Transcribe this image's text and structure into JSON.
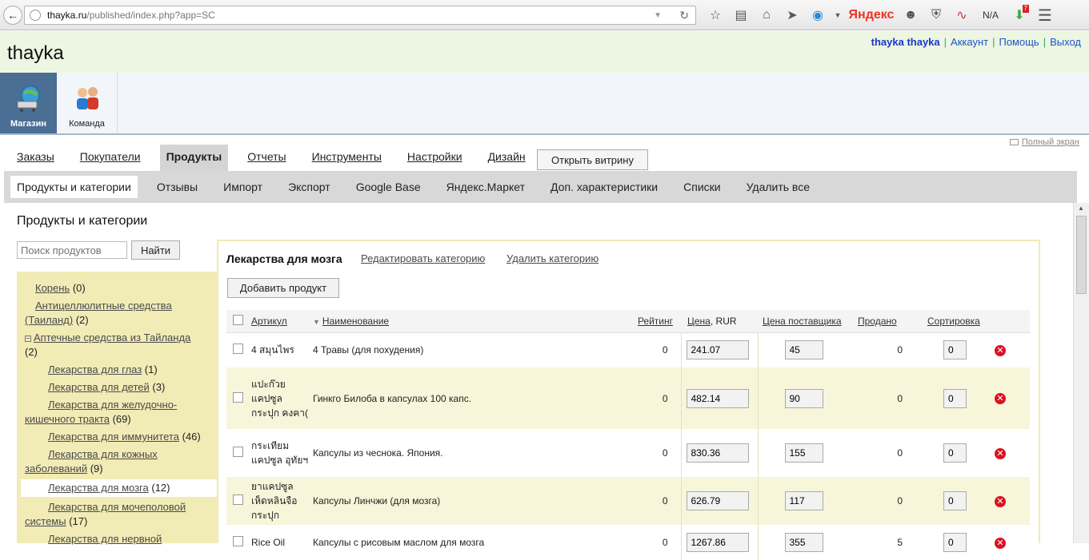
{
  "browser": {
    "url_host": "thayka.ru",
    "url_path": "/published/index.php?app=SC",
    "yandex_label": "Яндекс",
    "weather_label": "N/A",
    "notification_count": "7"
  },
  "header": {
    "brand": "thayka",
    "username": "thayka thayka",
    "account_link": "Аккаунт",
    "help_link": "Помощь",
    "logout_link": "Выход"
  },
  "apps": {
    "shop_label": "Магазин",
    "team_label": "Команда"
  },
  "fullscreen_label": "Полный экран",
  "main_nav": {
    "orders": "Заказы",
    "customers": "Покупатели",
    "products": "Продукты",
    "reports": "Отчеты",
    "tools": "Инструменты",
    "settings": "Настройки",
    "design": "Дизайн",
    "storefront_button": "Открыть витрину"
  },
  "sub_nav": {
    "products_categories": "Продукты и категории",
    "reviews": "Отзывы",
    "import": "Импорт",
    "export": "Экспорт",
    "google_base": "Google Base",
    "yandex_market": "Яндекс.Маркет",
    "extra_features": "Доп. характеристики",
    "lists": "Списки",
    "delete_all": "Удалить все"
  },
  "page": {
    "title": "Продукты и категории",
    "search_placeholder": "Поиск продуктов",
    "search_button": "Найти"
  },
  "tree": {
    "root": "Корень",
    "root_count": "(0)",
    "cellulite": "Антицеллюлитные средства (Таиланд)",
    "cellulite_count": "(2)",
    "pharmacy": "Аптечные средства из Тайланда",
    "pharmacy_count": "(2)",
    "eyes": "Лекарства для глаз",
    "eyes_count": "(1)",
    "kids": "Лекарства для детей",
    "kids_count": "(3)",
    "gi": "Лекарства для желудочно-кишечного тракта",
    "gi_count": "(69)",
    "immunity": "Лекарства для иммунитета",
    "immunity_count": "(46)",
    "skin": "Лекарства для кожных заболеваний",
    "skin_count": "(9)",
    "brain": "Лекарства для мозга",
    "brain_count": "(12)",
    "urogenital": "Лекарства для мочеполовой системы",
    "urogenital_count": "(17)",
    "nervous": "Лекарства для нервной"
  },
  "category": {
    "name": "Лекарства для мозга",
    "edit_link": "Редактировать категорию",
    "delete_link": "Удалить категорию",
    "add_button": "Добавить продукт"
  },
  "table": {
    "headers": {
      "sku": "Артикул",
      "name": "Наименование",
      "rating": "Рейтинг",
      "price": "Цена",
      "currency": ", RUR",
      "supplier_price": "Цена поставщика",
      "sold": "Продано",
      "sort": "Сортировка"
    },
    "rows": [
      {
        "sku": "4 สมุนไพร",
        "name": "4 Травы (для похудения)",
        "rating": "0",
        "price": "241.07",
        "supplier_price": "45",
        "sold": "0",
        "sort": "0"
      },
      {
        "sku": "แปะก๊วย แคปซูล กระปุก คงคา(",
        "name": "Гинкго Билоба в капсулах 100 капс.",
        "rating": "0",
        "price": "482.14",
        "supplier_price": "90",
        "sold": "0",
        "sort": "0"
      },
      {
        "sku": "กระเทียม แคปซูล อุทัยฯ",
        "name": "Капсулы из чеснока. Япония.",
        "rating": "0",
        "price": "830.36",
        "supplier_price": "155",
        "sold": "0",
        "sort": "0"
      },
      {
        "sku": "ยาแคปซูล เห็ดหลินจือ กระปุก",
        "name": "Капсулы Линчжи (для мозга)",
        "rating": "0",
        "price": "626.79",
        "supplier_price": "117",
        "sold": "0",
        "sort": "0"
      },
      {
        "sku": "Rice Oil",
        "name": "Капсулы с рисовым маслом для мозга",
        "rating": "0",
        "price": "1267.86",
        "supplier_price": "355",
        "sold": "5",
        "sort": "0"
      }
    ]
  }
}
